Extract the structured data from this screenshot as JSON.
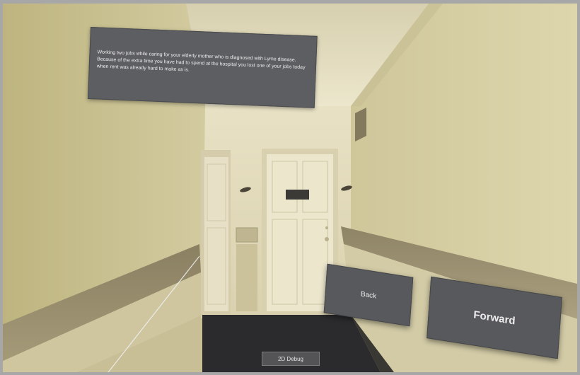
{
  "scene": {
    "door_sign": "",
    "colors": {
      "wall_left": "#c7bf8c",
      "wall_right": "#d7d0a6",
      "ceiling": "#e4ddc0",
      "wainscot": "#9a8f6d",
      "floor": "#2a2a2c",
      "door": "#e9e2c8",
      "panel": "#5d5e62"
    }
  },
  "story": {
    "text": "Working two jobs while caring for your elderly mother who is diagnosed with Lyme disease. Because of the extra time you have had to spend at the hospital you lost one of your jobs today when rent was already hard to make as is."
  },
  "navigation": {
    "back_label": "Back",
    "forward_label": "Forward"
  },
  "debug": {
    "label": "2D Debug"
  }
}
